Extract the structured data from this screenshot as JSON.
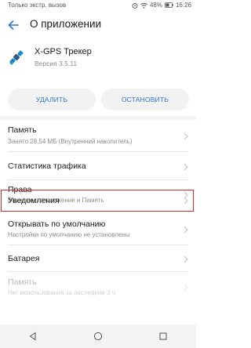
{
  "status_bar": {
    "carrier_text": "Только экстр. вызов",
    "battery": "48%",
    "time": "16:26",
    "icons": [
      "alarm-icon",
      "wifi-icon",
      "battery-icon"
    ]
  },
  "app_bar": {
    "back_icon": "back-arrow-icon",
    "title": "О приложении"
  },
  "app": {
    "icon": "satellite-icon",
    "name": "X-GPS Трекер",
    "version": "Версия 3.5.11"
  },
  "buttons": {
    "delete": "УДАЛИТЬ",
    "stop": "ОСТАНОВИТЬ"
  },
  "settings": [
    {
      "title": "Память",
      "subtitle": "Занято 28,54 МБ (Внутренний накопитель)",
      "enabled": true
    },
    {
      "title": "Статистика трафика",
      "subtitle": "",
      "enabled": true
    },
    {
      "title": "Права",
      "subtitle": "Ваше местоположение и Память",
      "enabled": true
    },
    {
      "title": "Уведомления",
      "subtitle": "",
      "enabled": true,
      "highlighted": true
    },
    {
      "title": "Открывать по умолчанию",
      "subtitle": "Настройки по умолчанию не установлены",
      "enabled": true
    },
    {
      "title": "Батарея",
      "subtitle": "",
      "enabled": true
    },
    {
      "title": "Память",
      "subtitle": "Нет использования за последние 3 ч",
      "enabled": false
    }
  ],
  "colors": {
    "accent": "#2f74d0",
    "highlight_border": "#e02a2a",
    "button_bg": "#f2f2f2"
  },
  "nav_bar": {
    "icons": [
      "back-triangle-icon",
      "home-circle-icon",
      "recents-square-icon"
    ]
  }
}
